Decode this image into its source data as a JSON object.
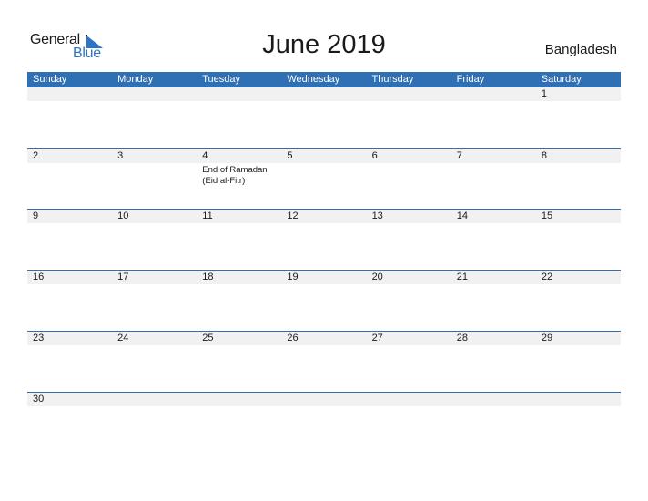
{
  "logo": {
    "text_general": "General",
    "text_blue": "Blue",
    "brand_color": "#2b75c4"
  },
  "title": "June 2019",
  "country": "Bangladesh",
  "colors": {
    "header_bg": "#2e70b3",
    "row_band": "#f1f1f1"
  },
  "weekdays": [
    "Sunday",
    "Monday",
    "Tuesday",
    "Wednesday",
    "Thursday",
    "Friday",
    "Saturday"
  ],
  "weeks": [
    {
      "days": [
        "",
        "",
        "",
        "",
        "",
        "",
        "1"
      ],
      "events": [
        "",
        "",
        "",
        "",
        "",
        "",
        ""
      ]
    },
    {
      "days": [
        "2",
        "3",
        "4",
        "5",
        "6",
        "7",
        "8"
      ],
      "events": [
        "",
        "",
        "End of Ramadan (Eid al-Fitr)",
        "",
        "",
        "",
        ""
      ]
    },
    {
      "days": [
        "9",
        "10",
        "11",
        "12",
        "13",
        "14",
        "15"
      ],
      "events": [
        "",
        "",
        "",
        "",
        "",
        "",
        ""
      ]
    },
    {
      "days": [
        "16",
        "17",
        "18",
        "19",
        "20",
        "21",
        "22"
      ],
      "events": [
        "",
        "",
        "",
        "",
        "",
        "",
        ""
      ]
    },
    {
      "days": [
        "23",
        "24",
        "25",
        "26",
        "27",
        "28",
        "29"
      ],
      "events": [
        "",
        "",
        "",
        "",
        "",
        "",
        ""
      ]
    },
    {
      "days": [
        "30",
        "",
        "",
        "",
        "",
        "",
        ""
      ],
      "events": [
        "",
        "",
        "",
        "",
        "",
        "",
        ""
      ]
    }
  ]
}
